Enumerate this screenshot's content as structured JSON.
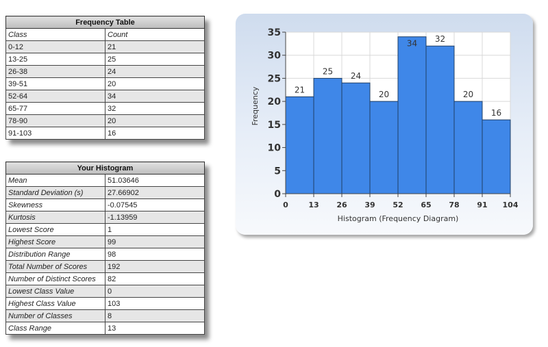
{
  "frequency_table": {
    "title": "Frequency Table",
    "headers": [
      "Class",
      "Count"
    ],
    "rows": [
      [
        "0-12",
        "21"
      ],
      [
        "13-25",
        "25"
      ],
      [
        "26-38",
        "24"
      ],
      [
        "39-51",
        "20"
      ],
      [
        "52-64",
        "34"
      ],
      [
        "65-77",
        "32"
      ],
      [
        "78-90",
        "20"
      ],
      [
        "91-103",
        "16"
      ]
    ]
  },
  "stats_table": {
    "title": "Your Histogram",
    "rows": [
      [
        "Mean",
        "51.03646"
      ],
      [
        "Standard Deviation (s)",
        "27.66902"
      ],
      [
        "Skewness",
        "-0.07545"
      ],
      [
        "Kurtosis",
        "-1.13959"
      ],
      [
        "Lowest Score",
        "1"
      ],
      [
        "Highest Score",
        "99"
      ],
      [
        "Distribution Range",
        "98"
      ],
      [
        "Total Number of Scores",
        "192"
      ],
      [
        "Number of Distinct Scores",
        "82"
      ],
      [
        "Lowest Class Value",
        "0"
      ],
      [
        "Highest Class Value",
        "103"
      ],
      [
        "Number of Classes",
        "8"
      ],
      [
        "Class Range",
        "13"
      ]
    ]
  },
  "colors": {
    "bar": "#3f87e8",
    "bar_edge": "#1f3f66",
    "grid": "#d8d8d8"
  },
  "chart_data": {
    "type": "bar",
    "title": "",
    "xlabel": "Histogram (Frequency Diagram)",
    "ylabel": "Frequency",
    "bin_edges": [
      0,
      13,
      26,
      39,
      52,
      65,
      78,
      91,
      104
    ],
    "categories": [
      "0-12",
      "13-25",
      "26-38",
      "39-51",
      "52-64",
      "65-77",
      "78-90",
      "91-103"
    ],
    "values": [
      21,
      25,
      24,
      20,
      34,
      32,
      20,
      16
    ],
    "x_ticks": [
      "0",
      "13",
      "26",
      "39",
      "52",
      "65",
      "78",
      "91",
      "104"
    ],
    "y_ticks": [
      0,
      5,
      10,
      15,
      20,
      25,
      30,
      35
    ],
    "xlim": [
      0,
      104
    ],
    "ylim": [
      0,
      35
    ],
    "grid": true,
    "legend": "none"
  }
}
